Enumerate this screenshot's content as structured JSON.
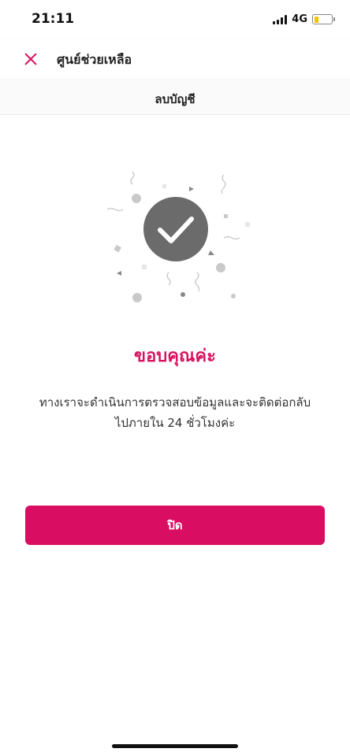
{
  "status_bar": {
    "time": "21:11",
    "network": "4G",
    "battery_level": 0.25,
    "battery_color": "#f4c300"
  },
  "header": {
    "close_icon": "close-icon",
    "title": "ศูนย์ช่วยเหลือ"
  },
  "subheader": {
    "title": "ลบบัญชี"
  },
  "illustration": {
    "icon": "check-circle-icon",
    "circle_color": "#6b6b6b"
  },
  "content": {
    "thanks_title": "ขอบคุณค่ะ",
    "message_line1": "ทางเราจะดำเนินการตรวจสอบข้อมูลและจะติดต่อกลับ",
    "message_line2": "ไปภายใน 24 ชั่วโมงค่ะ"
  },
  "actions": {
    "close_label": "ปิด"
  },
  "colors": {
    "accent": "#d6135f",
    "button": "#d90d62"
  }
}
